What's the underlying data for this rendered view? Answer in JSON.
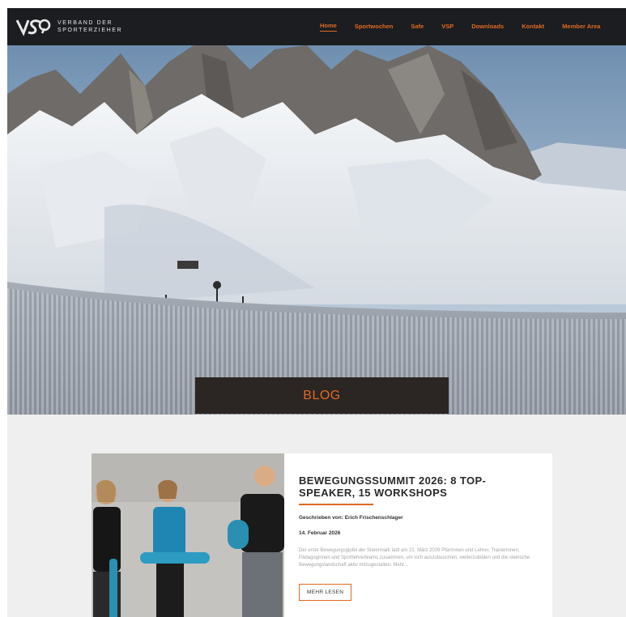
{
  "brand": {
    "line1": "VERBAND DER",
    "line2": "SPORTERZIEHER",
    "accent": "#e06a24",
    "header_bg": "#1b1d20"
  },
  "nav": {
    "items": [
      "Home",
      "Sportwochen",
      "Safe",
      "VSP",
      "Downloads",
      "Kontakt",
      "Member Area"
    ]
  },
  "hero": {
    "heading": "BLOG"
  },
  "post": {
    "title": "BEWEGUNGSSUMMIT 2026: 8 TOP-SPEAKER, 15 WORKSHOPS",
    "author": "Geschrieben von: Erich Frischenschlager",
    "date": "14. Februar 2026",
    "excerpt": "Der erste Bewegungsgipfel der Steiermark lädt am 21. März 2026 Pfarrinnen und Lehrer, Trainerinnen, Pädagoginnen und Sportlehrerteams zusammen, um sich auszutauschen, weiterzubilden und die steirische Bewegungslandschaft aktiv mitzugestalten. Mehr...",
    "button": "MEHR LESEN"
  }
}
